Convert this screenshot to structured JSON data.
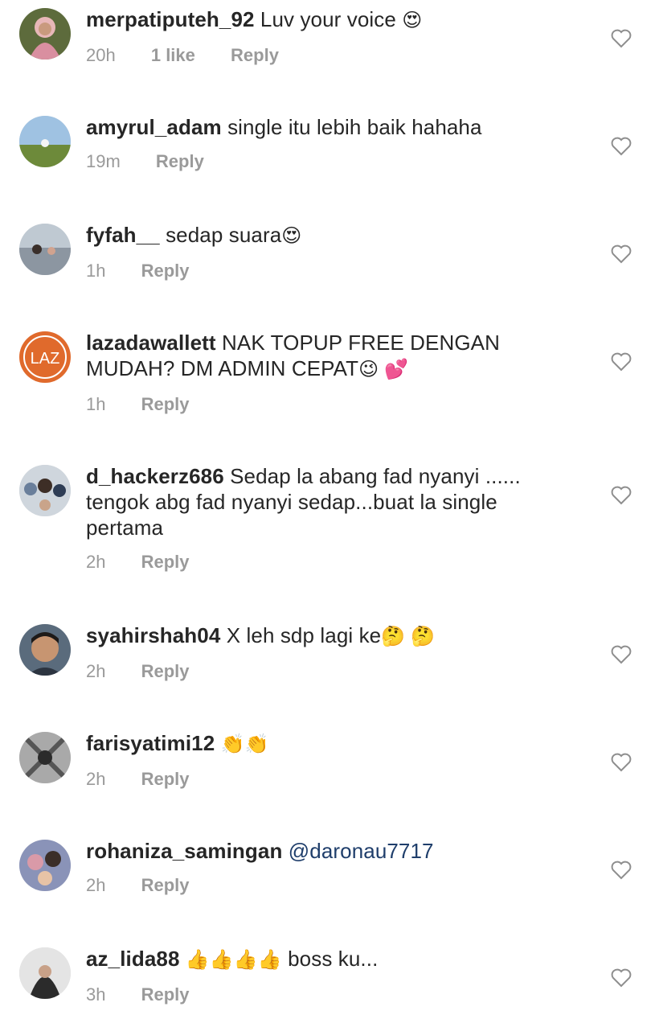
{
  "comments": [
    {
      "user": "merpatiputeh_92",
      "text": "Luv your voice",
      "emoji": "😍",
      "time": "20h",
      "likes": "1 like",
      "reply": "Reply"
    },
    {
      "user": "amyrul_adam",
      "text": "single itu lebih baik hahaha",
      "emoji": "",
      "time": "19m",
      "likes": "",
      "reply": "Reply"
    },
    {
      "user": "fyfah__",
      "text": "sedap suara",
      "emoji": "😍",
      "time": "1h",
      "likes": "",
      "reply": "Reply"
    },
    {
      "user": "lazadawallett",
      "text": "NAK TOPUP FREE DENGAN MUDAH? DM ADMIN CEPAT",
      "emoji": "😉 💕",
      "time": "1h",
      "likes": "",
      "reply": "Reply",
      "avatar_text": "LAZ"
    },
    {
      "user": "d_hackerz686",
      "text": "Sedap la abang fad nyanyi ...... tengok abg fad nyanyi sedap...buat la single pertama",
      "emoji": "",
      "time": "2h",
      "likes": "",
      "reply": "Reply"
    },
    {
      "user": "syahirshah04",
      "text": "X leh sdp lagi ke",
      "emoji": "🤔 🤔",
      "time": "2h",
      "likes": "",
      "reply": "Reply"
    },
    {
      "user": "farisyatimi12",
      "text": "",
      "emoji": "👏👏",
      "time": "2h",
      "likes": "",
      "reply": "Reply"
    },
    {
      "user": "rohaniza_samingan",
      "text": "",
      "mention": "@daronau7717",
      "emoji": "",
      "time": "2h",
      "likes": "",
      "reply": "Reply"
    },
    {
      "user": "az_lida88",
      "text": "boss ku...",
      "emoji": "👍👍👍👍",
      "emoji_before": true,
      "time": "3h",
      "likes": "",
      "reply": "Reply"
    }
  ],
  "colors": {
    "username": "#262626",
    "meta": "#9a9a9a",
    "mention": "#1f3e6b",
    "heart": "#8e8e8e",
    "laz": "#e06a2c"
  }
}
